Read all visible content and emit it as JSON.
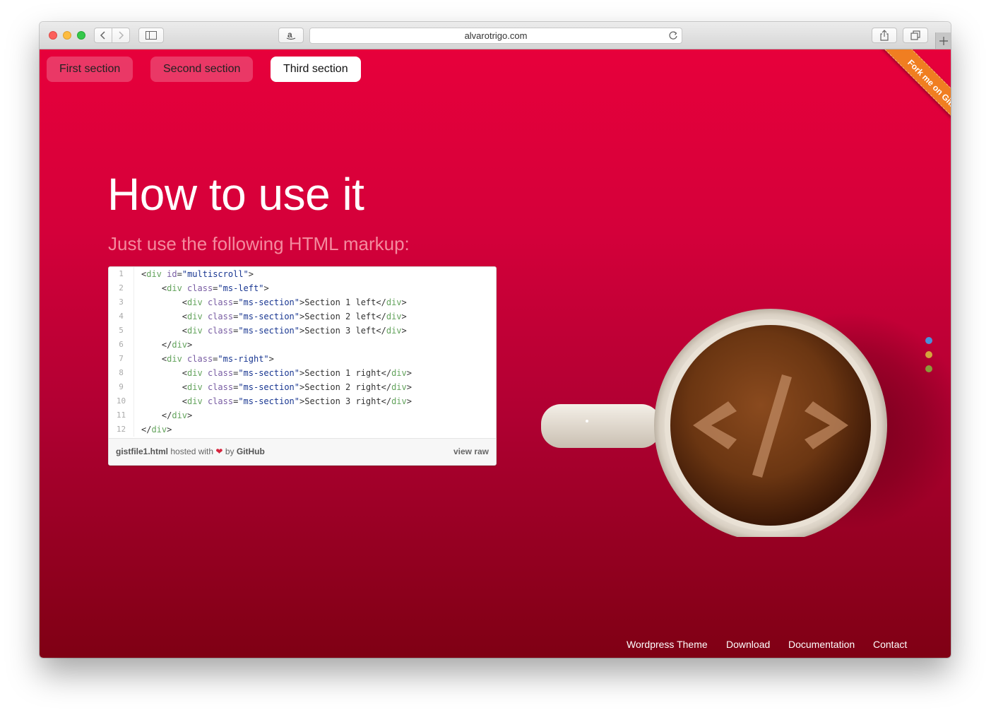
{
  "browser": {
    "url": "alvarotrigo.com"
  },
  "menu": {
    "items": [
      {
        "label": "First section"
      },
      {
        "label": "Second section"
      },
      {
        "label": "Third section"
      }
    ]
  },
  "ribbon": {
    "label": "Fork me on GitHub"
  },
  "main": {
    "title": "How to use it",
    "subtitle": "Just use the following HTML markup:"
  },
  "gist": {
    "lines": [
      {
        "n": "1",
        "code": "<div id=\"multiscroll\">"
      },
      {
        "n": "2",
        "code": "    <div class=\"ms-left\">"
      },
      {
        "n": "3",
        "code": "        <div class=\"ms-section\">Section 1 left</div>"
      },
      {
        "n": "4",
        "code": "        <div class=\"ms-section\">Section 2 left</div>"
      },
      {
        "n": "5",
        "code": "        <div class=\"ms-section\">Section 3 left</div>"
      },
      {
        "n": "6",
        "code": "    </div>"
      },
      {
        "n": "7",
        "code": "    <div class=\"ms-right\">"
      },
      {
        "n": "8",
        "code": "        <div class=\"ms-section\">Section 1 right</div>"
      },
      {
        "n": "9",
        "code": "        <div class=\"ms-section\">Section 2 right</div>"
      },
      {
        "n": "10",
        "code": "        <div class=\"ms-section\">Section 3 right</div>"
      },
      {
        "n": "11",
        "code": "    </div>"
      },
      {
        "n": "12",
        "code": "</div>"
      }
    ],
    "filename": "gistfile1.html",
    "hosted_with": "hosted with",
    "by": "by",
    "host": "GitHub",
    "view_raw": "view raw"
  },
  "dots": {
    "colors": [
      "#4a90d9",
      "#d4a53c",
      "#8a9a3a"
    ]
  },
  "footer": {
    "links": [
      "Wordpress Theme",
      "Download",
      "Documentation",
      "Contact"
    ]
  },
  "colors": {
    "page_top": "#e7003b",
    "page_bottom": "#7f0014",
    "ribbon": "#f07e21"
  }
}
